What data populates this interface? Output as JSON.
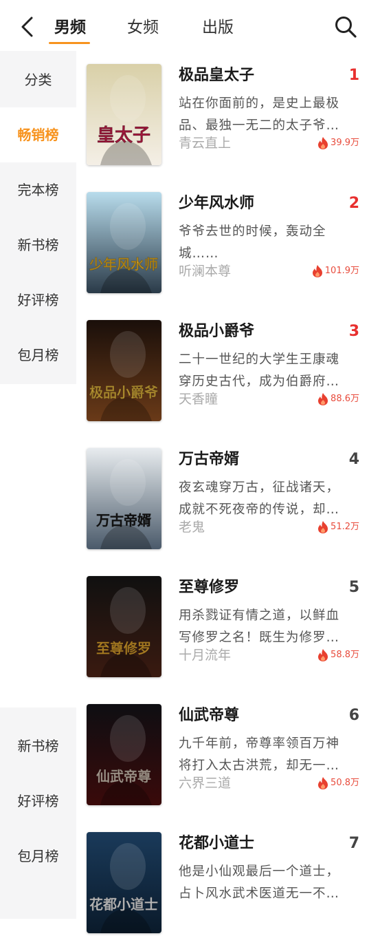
{
  "header": {
    "tabs": [
      {
        "label": "男频",
        "active": true
      },
      {
        "label": "女频",
        "active": false
      },
      {
        "label": "出版",
        "active": false
      }
    ]
  },
  "sidebar": {
    "items_top": [
      "分类",
      "畅销榜",
      "完本榜",
      "新书榜",
      "好评榜",
      "包月榜"
    ],
    "active": "畅销榜",
    "items_bottom": [
      "新书榜",
      "好评榜",
      "包月榜"
    ]
  },
  "colors": {
    "accent": "#f7931e",
    "rank_top": "#e8302f",
    "heat": "#e84c3d"
  },
  "books": [
    {
      "rank": "1",
      "title": "极品皇太子",
      "desc1": "站在你面前的，是史上最极",
      "desc2": "品、最独一无二的太子爷…",
      "author": "青云直上",
      "heat": "39.9万",
      "cover_text": "皇太子",
      "cover_top": "#d9d0a8",
      "cover_bottom": "#f4efe6",
      "cover_accent": "#c81e4a"
    },
    {
      "rank": "2",
      "title": "少年风水师",
      "desc1": "爷爷去世的时候，轰动全",
      "desc2": "城……",
      "author": "听澜本尊",
      "heat": "101.9万",
      "cover_text": "少年风水师",
      "cover_top": "#b8dcec",
      "cover_bottom": "#2a3a48",
      "cover_accent": "#f2b825"
    },
    {
      "rank": "3",
      "title": "极品小爵爷",
      "desc1": "二十一世纪的大学生王康魂",
      "desc2": "穿历史古代，成为伯爵府…",
      "author": "天香瞳",
      "heat": "88.6万",
      "cover_text": "极品小爵爷",
      "cover_top": "#1a0f0a",
      "cover_bottom": "#6a3a18",
      "cover_accent": "#f0c040"
    },
    {
      "rank": "4",
      "title": "万古帝婿",
      "desc1": "夜玄魂穿万古，征战诸天，",
      "desc2": "成就不死夜帝的传说，却…",
      "author": "老鬼",
      "heat": "51.2万",
      "cover_text": "万古帝婿",
      "cover_top": "#e8ecef",
      "cover_bottom": "#4a5a6a",
      "cover_accent": "#1a1a1a"
    },
    {
      "rank": "5",
      "title": "至尊修罗",
      "desc1": "用杀戮证有情之道，以鲜血",
      "desc2": "写修罗之名！既生为修罗…",
      "author": "十月流年",
      "heat": "58.8万",
      "cover_text": "至尊修罗",
      "cover_top": "#101010",
      "cover_bottom": "#3a1a10",
      "cover_accent": "#f0b030"
    },
    {
      "rank": "6",
      "title": "仙武帝尊",
      "desc1": "九千年前，帝尊率领百万神",
      "desc2": "将打入太古洪荒，却无一…",
      "author": "六界三道",
      "heat": "50.8万",
      "cover_text": "仙武帝尊",
      "cover_top": "#0e0e12",
      "cover_bottom": "#3a0a0a",
      "cover_accent": "#e0d0c0"
    },
    {
      "rank": "7",
      "title": "花都小道士",
      "desc1": "他是小仙观最后一个道士，",
      "desc2": "占卜风水武术医道无一不…",
      "author": "",
      "heat": "",
      "cover_text": "花都小道士",
      "cover_top": "#1a3a5a",
      "cover_bottom": "#0a1a2a",
      "cover_accent": "#ffffff"
    }
  ]
}
